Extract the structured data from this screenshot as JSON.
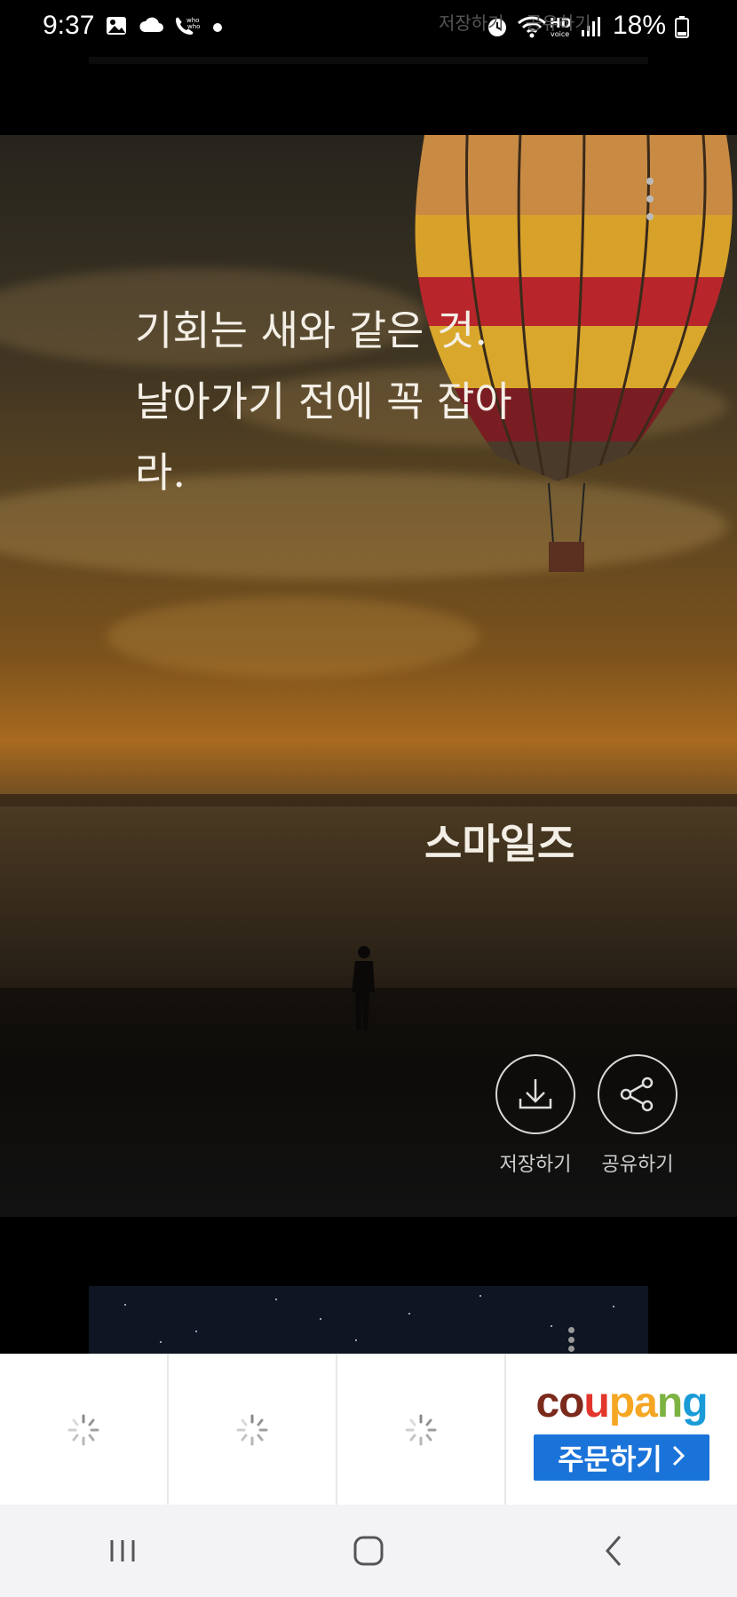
{
  "status_bar": {
    "time": "9:37",
    "battery": "18%",
    "icons": [
      "gallery-icon",
      "cloud-icon",
      "whowho-call-icon",
      "dot-icon",
      "alarm-icon",
      "wifi-icon",
      "hd-voice-icon",
      "signal-icon",
      "battery-icon"
    ]
  },
  "ghost_actions": [
    "저장하기",
    "공유하기"
  ],
  "card": {
    "quote": "기회는 새와 같은 것.\n 날아가기 전에 꼭 잡아\n라.",
    "author": "스마일즈",
    "save_label": "저장하기",
    "share_label": "공유하기",
    "more_icon": "more-vertical-icon"
  },
  "ad": {
    "brand": "coupang",
    "brand_colors": [
      "#7b2a1c",
      "#e2352b",
      "#f5a623",
      "#7cb342",
      "#1a9bd7"
    ],
    "order_label": "주문하기",
    "slots": [
      "loading-spinner",
      "loading-spinner",
      "loading-spinner"
    ]
  },
  "nav": {
    "buttons": [
      "recent-apps-icon",
      "home-icon",
      "back-icon"
    ]
  }
}
